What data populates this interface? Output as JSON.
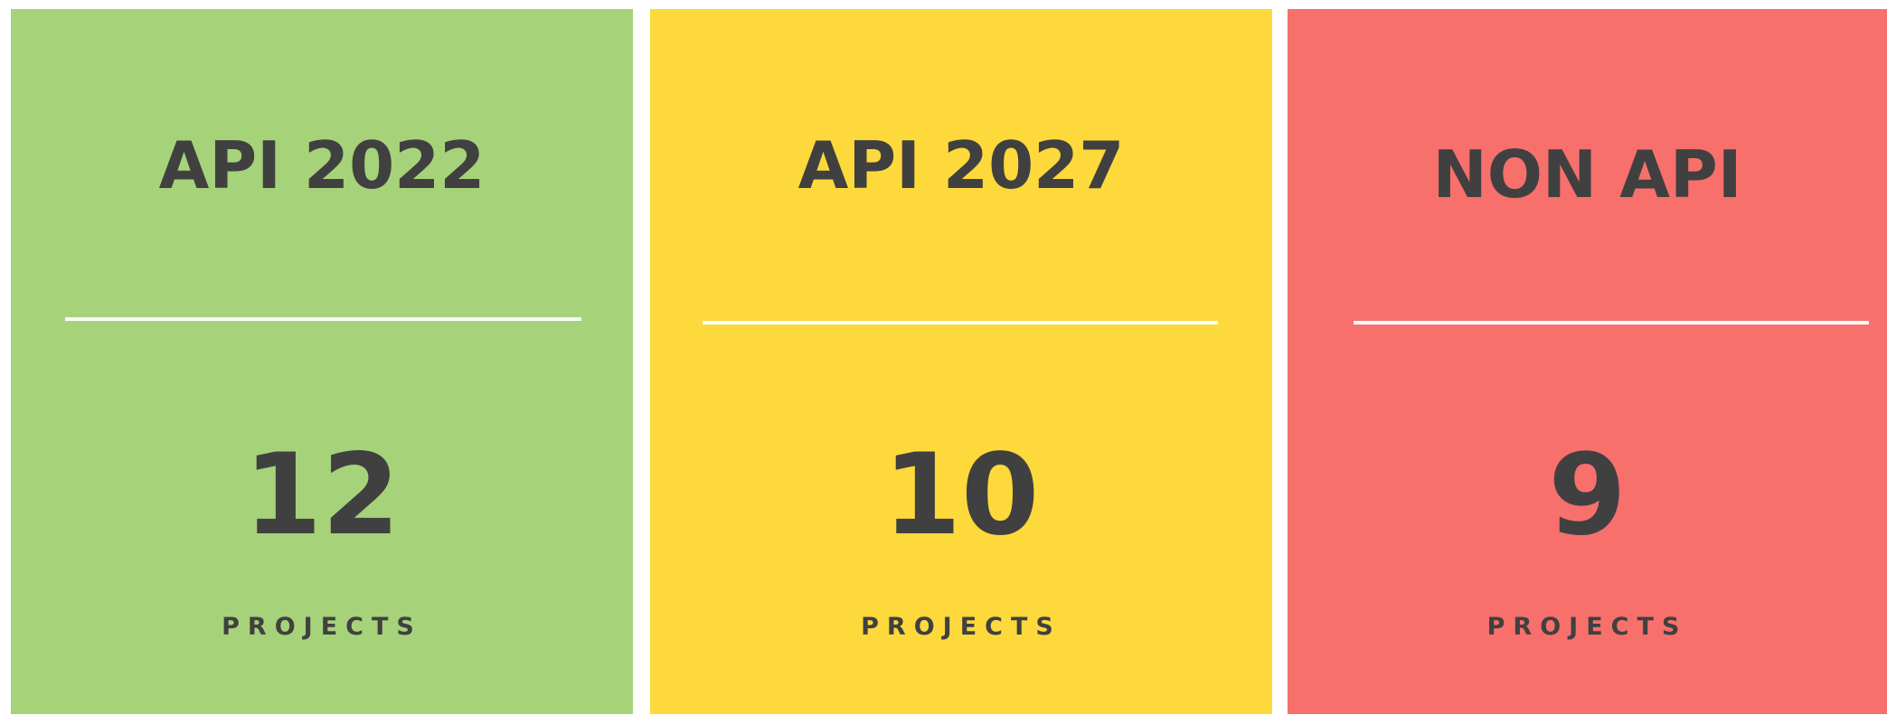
{
  "colors": {
    "text": "#404040",
    "divider": "#ffffff"
  },
  "cards": [
    {
      "title": "API 2022",
      "count": "12",
      "unit": "PROJECTS",
      "color": "#a6d37a"
    },
    {
      "title": "API 2027",
      "count": "10",
      "unit": "PROJECTS",
      "color": "#fed93b"
    },
    {
      "title": "NON API",
      "count": "9",
      "unit": "PROJECTS",
      "color": "#f7706c"
    }
  ]
}
